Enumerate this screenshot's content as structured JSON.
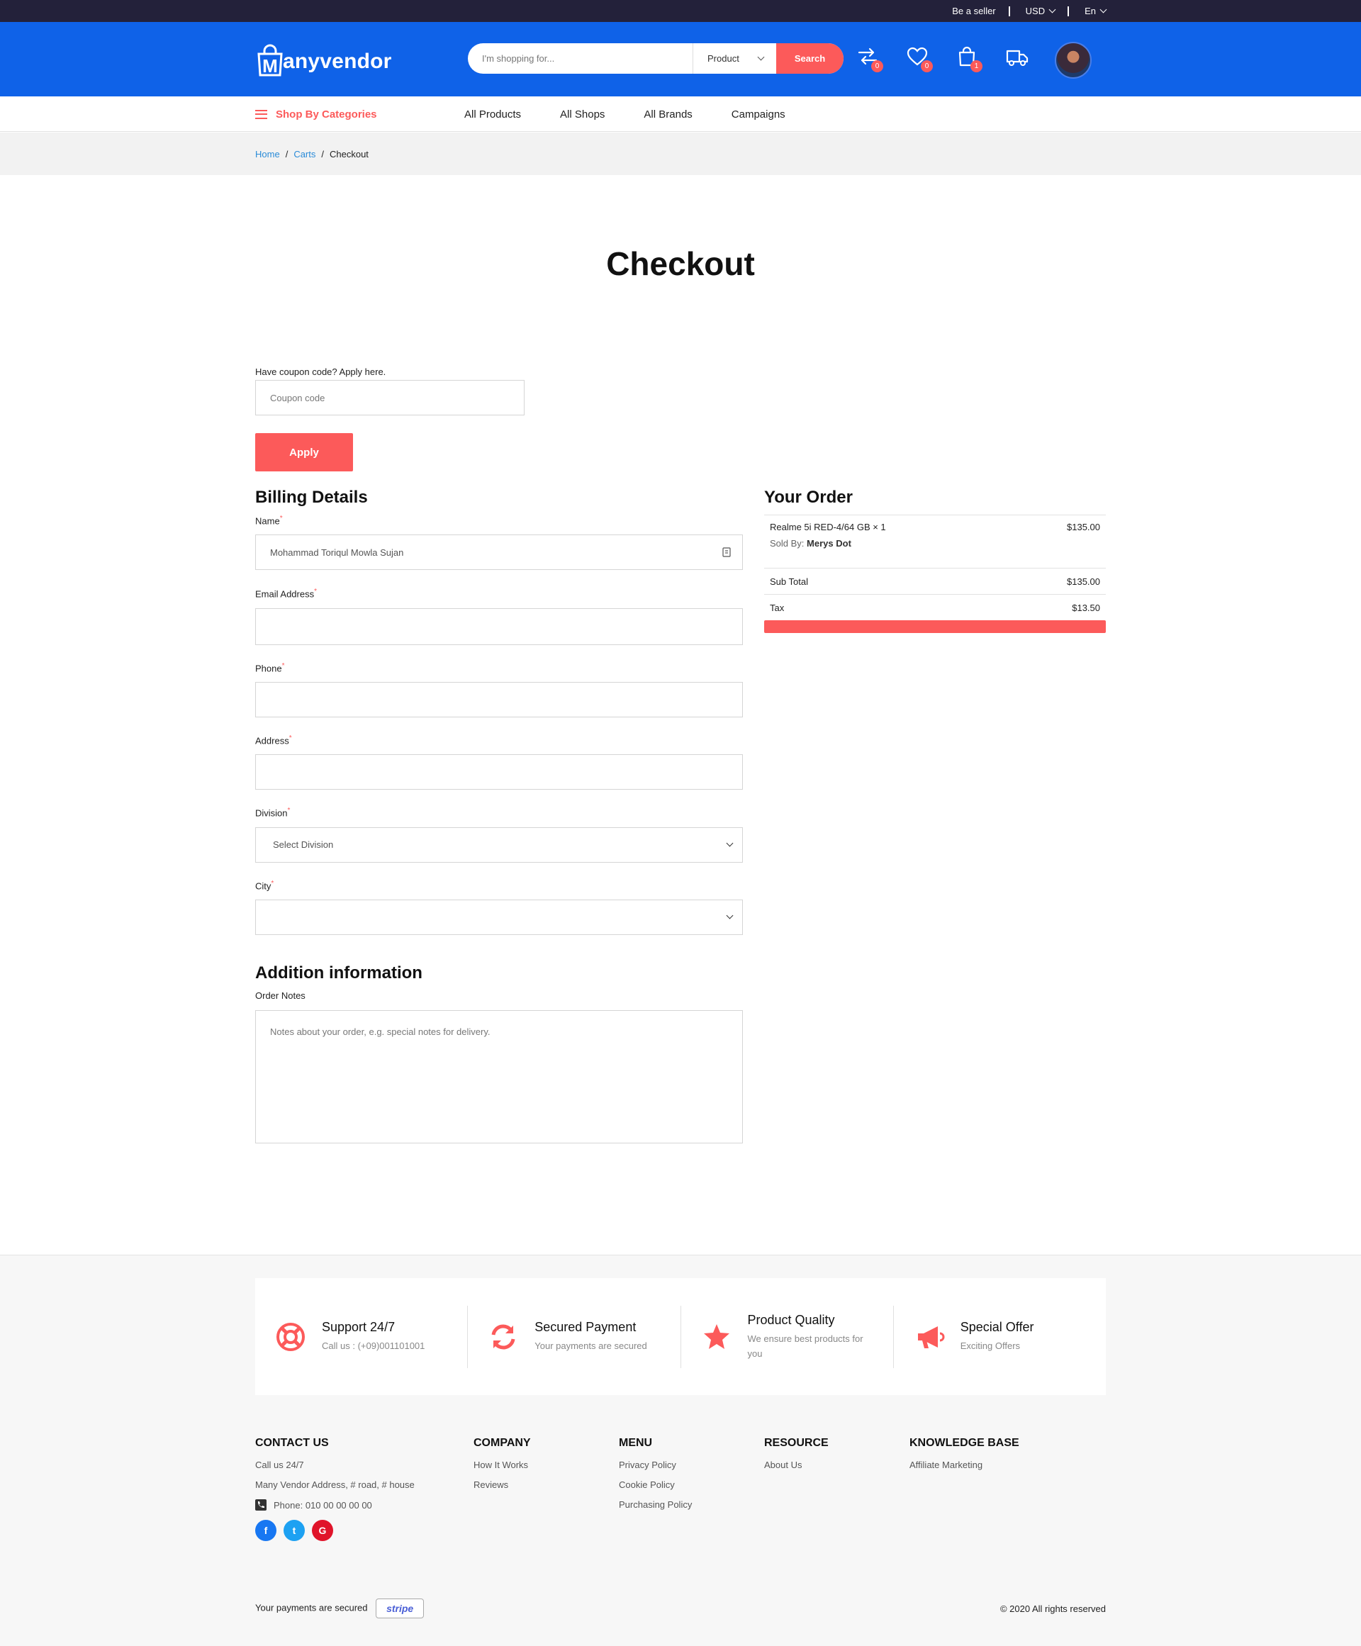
{
  "topbar": {
    "seller": "Be a seller",
    "currency": "USD",
    "language": "En"
  },
  "header": {
    "logo_initial": "M",
    "logo_rest": "anyvendor",
    "search_placeholder": "I'm shopping for...",
    "search_category": "Product",
    "search_button": "Search",
    "compare_count": "0",
    "wishlist_count": "0",
    "cart_count": "1"
  },
  "nav": {
    "categories": "Shop By Categories",
    "links": [
      "All Products",
      "All Shops",
      "All Brands",
      "Campaigns"
    ]
  },
  "breadcrumb": {
    "home": "Home",
    "carts": "Carts",
    "current": "Checkout"
  },
  "page_title": "Checkout",
  "coupon": {
    "label": "Have coupon code? Apply here.",
    "placeholder": "Coupon code",
    "button": "Apply"
  },
  "billing": {
    "heading": "Billing Details",
    "name_label": "Name",
    "name_value": "Mohammad Toriqul Mowla Sujan",
    "email_label": "Email Address",
    "phone_label": "Phone",
    "address_label": "Address",
    "division_label": "Division",
    "division_value": "Select Division",
    "city_label": "City",
    "required_mark": "*"
  },
  "additional": {
    "heading": "Addition information",
    "notes_label": "Order Notes",
    "notes_placeholder": "Notes about your order, e.g. special notes for delivery."
  },
  "order": {
    "heading": "Your Order",
    "item_name": "Realme 5i RED-4/64 GB × 1",
    "item_price": "$135.00",
    "sold_by_label": "Sold By:",
    "sold_by_value": "Merys Dot",
    "subtotal_label": "Sub Total",
    "subtotal_value": "$135.00",
    "tax_label": "Tax",
    "tax_value": "$13.50"
  },
  "features": [
    {
      "title": "Support 24/7",
      "subtitle": "Call us : (+09)001101001",
      "icon": "lifebuoy-icon"
    },
    {
      "title": "Secured Payment",
      "subtitle": "Your payments are secured",
      "icon": "refresh-icon"
    },
    {
      "title": "Product Quality",
      "subtitle": "We ensure best products for you",
      "icon": "star-icon"
    },
    {
      "title": "Special Offer",
      "subtitle": "Exciting Offers",
      "icon": "megaphone-icon"
    }
  ],
  "footer": {
    "contact": {
      "heading": "CONTACT US",
      "call": "Call us 24/7",
      "address": "Many Vendor Address, # road, # house",
      "phone": "Phone: 010 00 00 00 00"
    },
    "company": {
      "heading": "COMPANY",
      "links": [
        "How It Works",
        "Reviews"
      ]
    },
    "menu": {
      "heading": "MENU",
      "links": [
        "Privacy Policy",
        "Cookie Policy",
        "Purchasing Policy"
      ]
    },
    "resource": {
      "heading": "RESOURCE",
      "links": [
        "About Us"
      ]
    },
    "knowledge": {
      "heading": "KNOWLEDGE BASE",
      "links": [
        "Affiliate Marketing"
      ]
    },
    "social": [
      "f",
      "t",
      "G"
    ],
    "payments_secured": "Your payments are secured",
    "pay_badge": "stripe",
    "copyright": "© 2020 All rights reserved"
  },
  "colors": {
    "primary_blue": "#0f62e8",
    "accent_red": "#fc5a5a",
    "topbar": "#23213a",
    "link_blue": "#2a8bd8"
  }
}
